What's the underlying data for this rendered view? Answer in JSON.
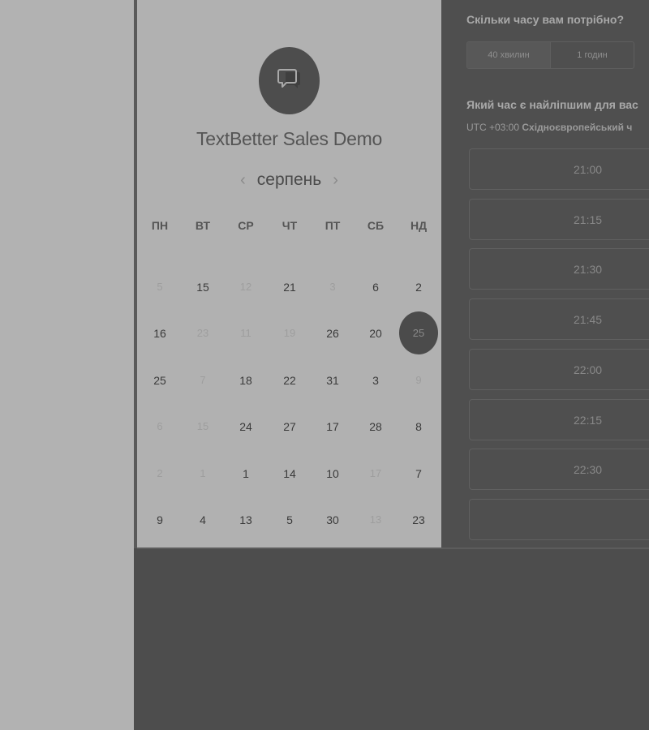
{
  "event": {
    "title": "TextBetter Sales Demo",
    "logo_icon": "chat-bubbles-icon"
  },
  "calendar": {
    "month": "серпень",
    "prev_icon": "‹",
    "next_icon": "›",
    "weekdays": [
      "ПН",
      "ВТ",
      "СР",
      "ЧТ",
      "ПТ",
      "СБ",
      "НД"
    ],
    "weeks": [
      [
        {
          "d": "5",
          "m": true
        },
        {
          "d": "15",
          "m": false
        },
        {
          "d": "12",
          "m": true
        },
        {
          "d": "21",
          "m": false
        },
        {
          "d": "3",
          "m": true
        },
        {
          "d": "6",
          "m": false
        },
        {
          "d": "2",
          "m": false
        }
      ],
      [
        {
          "d": "16",
          "m": false
        },
        {
          "d": "23",
          "m": true
        },
        {
          "d": "11",
          "m": true
        },
        {
          "d": "19",
          "m": true
        },
        {
          "d": "26",
          "m": false
        },
        {
          "d": "20",
          "m": false
        },
        {
          "d": "25",
          "m": false,
          "selected": true
        }
      ],
      [
        {
          "d": "25",
          "m": false
        },
        {
          "d": "7",
          "m": true
        },
        {
          "d": "18",
          "m": false
        },
        {
          "d": "22",
          "m": false
        },
        {
          "d": "31",
          "m": false
        },
        {
          "d": "3",
          "m": false
        },
        {
          "d": "9",
          "m": true
        }
      ],
      [
        {
          "d": "6",
          "m": true
        },
        {
          "d": "15",
          "m": true
        },
        {
          "d": "24",
          "m": false
        },
        {
          "d": "27",
          "m": false
        },
        {
          "d": "17",
          "m": false
        },
        {
          "d": "28",
          "m": false
        },
        {
          "d": "8",
          "m": false
        }
      ],
      [
        {
          "d": "2",
          "m": true
        },
        {
          "d": "1",
          "m": true
        },
        {
          "d": "1",
          "m": false
        },
        {
          "d": "14",
          "m": false
        },
        {
          "d": "10",
          "m": false
        },
        {
          "d": "17",
          "m": true
        },
        {
          "d": "7",
          "m": false
        }
      ],
      [
        {
          "d": "9",
          "m": false
        },
        {
          "d": "4",
          "m": false
        },
        {
          "d": "13",
          "m": false
        },
        {
          "d": "5",
          "m": false
        },
        {
          "d": "30",
          "m": false
        },
        {
          "d": "13",
          "m": true
        },
        {
          "d": "23",
          "m": false
        }
      ]
    ]
  },
  "booking": {
    "duration_question": "Скільки часу вам потрібно?",
    "durations": [
      "40 хвилин",
      "1 годин"
    ],
    "time_question": "Який час є найліпшим для вас",
    "timezone_offset": "UTC +03:00",
    "timezone_name": "Східноєвропейський ч",
    "slots": [
      "21:00",
      "21:15",
      "21:30",
      "21:45",
      "22:00",
      "22:15",
      "22:30"
    ]
  }
}
